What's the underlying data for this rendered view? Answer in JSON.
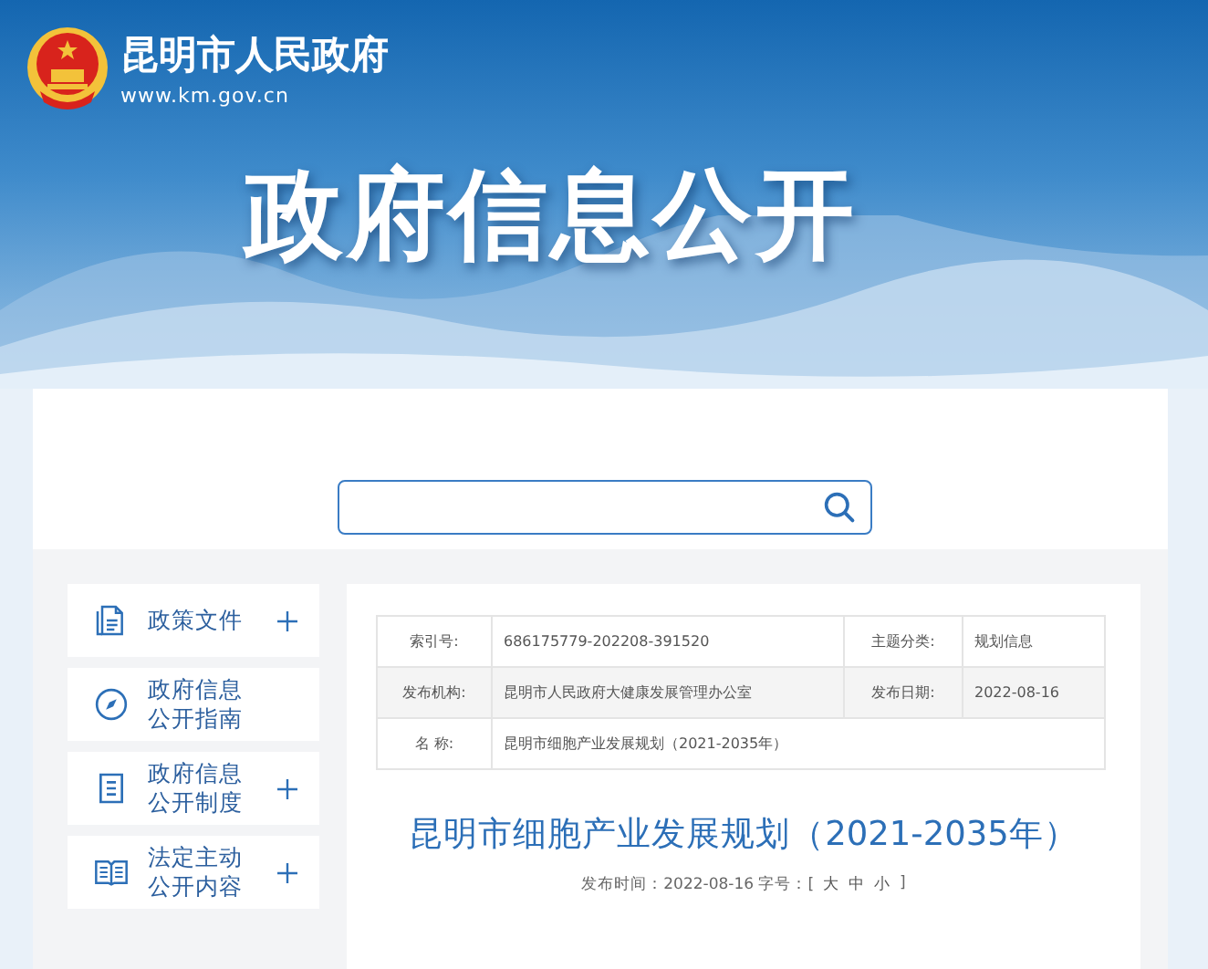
{
  "header": {
    "site_name": "昆明市人民政府",
    "url": "www.km.gov.cn",
    "banner_title": "政府信息公开"
  },
  "sidebar": {
    "items": [
      {
        "kind": "document",
        "label": "政策文件",
        "expandable": true
      },
      {
        "kind": "compass",
        "label": "政府信息公开指南",
        "expandable": false
      },
      {
        "kind": "notepad",
        "label": "政府信息公开制度",
        "expandable": true
      },
      {
        "kind": "book",
        "label": "法定主动公开内容",
        "expandable": true
      }
    ]
  },
  "info_table": {
    "rows": [
      {
        "cells": [
          {
            "label": "索引号:",
            "value": "686175779-202208-391520"
          },
          {
            "label": "主题分类:",
            "value": "规划信息"
          }
        ]
      },
      {
        "cells": [
          {
            "label": "发布机构:",
            "value": "昆明市人民政府大健康发展管理办公室"
          },
          {
            "label": "发布日期:",
            "value": "2022-08-16"
          }
        ]
      },
      {
        "cells": [
          {
            "label": "名 称:",
            "value": "昆明市细胞产业发展规划（2021-2035年）"
          }
        ]
      }
    ]
  },
  "article": {
    "title": "昆明市细胞产业发展规划（2021-2035年）",
    "meta_label": "发布时间：2022-08-16 字号：[",
    "font_sizes": [
      "大",
      "中",
      "小"
    ],
    "meta_end": "]"
  }
}
